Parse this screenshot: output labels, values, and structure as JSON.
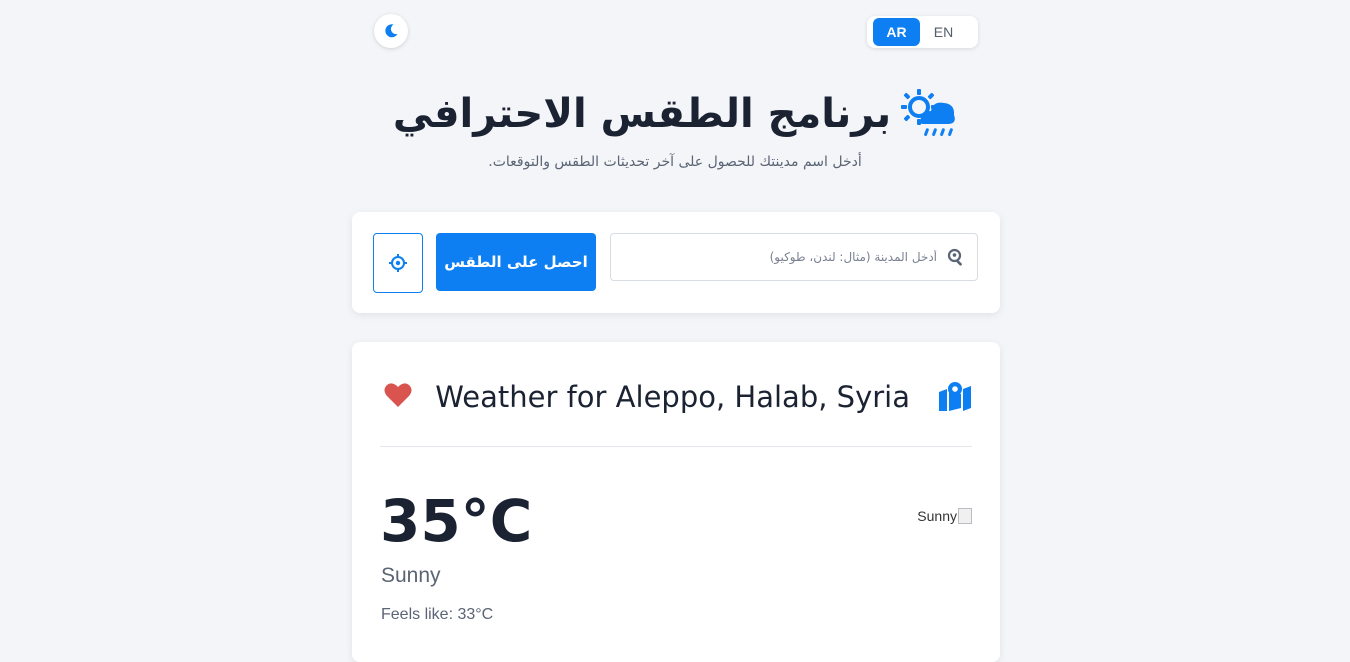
{
  "theme": {
    "icon": "moon-icon"
  },
  "language": {
    "options": [
      "AR",
      "EN"
    ],
    "selected": "AR"
  },
  "header": {
    "title": "برنامج الطقس الاحترافي",
    "subtitle": "أدخل اسم مدينتك للحصول على آخر تحديثات الطقس والتوقعات.",
    "icon": "sun-rain-cloud-icon"
  },
  "search": {
    "placeholder": "أدخل المدينة (مثال: لندن، طوكيو)",
    "value": "",
    "get_weather_label": "احصل على الطقس",
    "locate_icon": "crosshair-icon",
    "search_icon": "search-location-icon"
  },
  "weather": {
    "location_title": "Weather for Aleppo, Halab, Syria",
    "temperature": "35°C",
    "condition": "Sunny",
    "feels_like": "Feels like: 33°C",
    "image_alt": "Sunny",
    "favorite_icon": "heart-icon",
    "map_icon": "map-icon"
  },
  "colors": {
    "accent": "#0d7ff2",
    "background": "#f3f5f9",
    "heart": "#d9534f",
    "text_dark": "#1b2333",
    "text_muted": "#5b6474"
  }
}
